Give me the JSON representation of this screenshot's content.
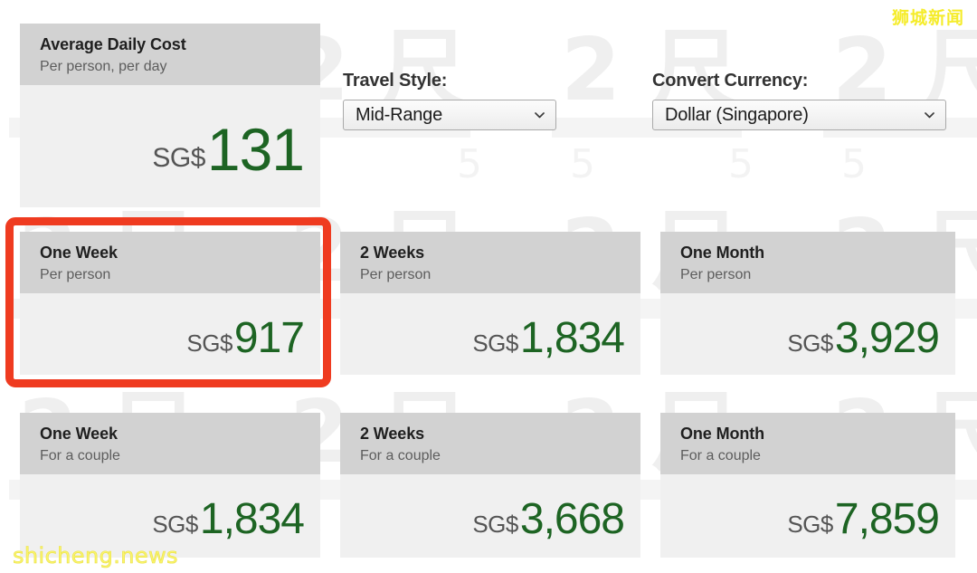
{
  "controls": {
    "travel_style": {
      "label": "Travel Style:",
      "value": "Mid-Range"
    },
    "currency": {
      "label": "Convert Currency:",
      "value": "Dollar (Singapore)"
    }
  },
  "daily_card": {
    "title": "Average Daily Cost",
    "subtitle": "Per person, per day",
    "currency": "SG$",
    "amount": "131"
  },
  "per_person_row": [
    {
      "title": "One Week",
      "subtitle": "Per person",
      "currency": "SG$",
      "amount": "917"
    },
    {
      "title": "2 Weeks",
      "subtitle": "Per person",
      "currency": "SG$",
      "amount": "1,834"
    },
    {
      "title": "One Month",
      "subtitle": "Per person",
      "currency": "SG$",
      "amount": "3,929"
    }
  ],
  "couple_row": [
    {
      "title": "One Week",
      "subtitle": "For a couple",
      "currency": "SG$",
      "amount": "1,834"
    },
    {
      "title": "2 Weeks",
      "subtitle": "For a couple",
      "currency": "SG$",
      "amount": "3,668"
    },
    {
      "title": "One Month",
      "subtitle": "For a couple",
      "currency": "SG$",
      "amount": "7,859"
    }
  ],
  "watermarks": {
    "top_right": "狮城新闻",
    "bottom_left": "shicheng.news"
  },
  "colors": {
    "amount_green": "#1d6423",
    "highlight_red": "#ef3b20",
    "card_header_gray": "#d2d2d2",
    "card_body_gray": "#f0f0f0",
    "watermark_yellow": "#f5ec2a"
  }
}
